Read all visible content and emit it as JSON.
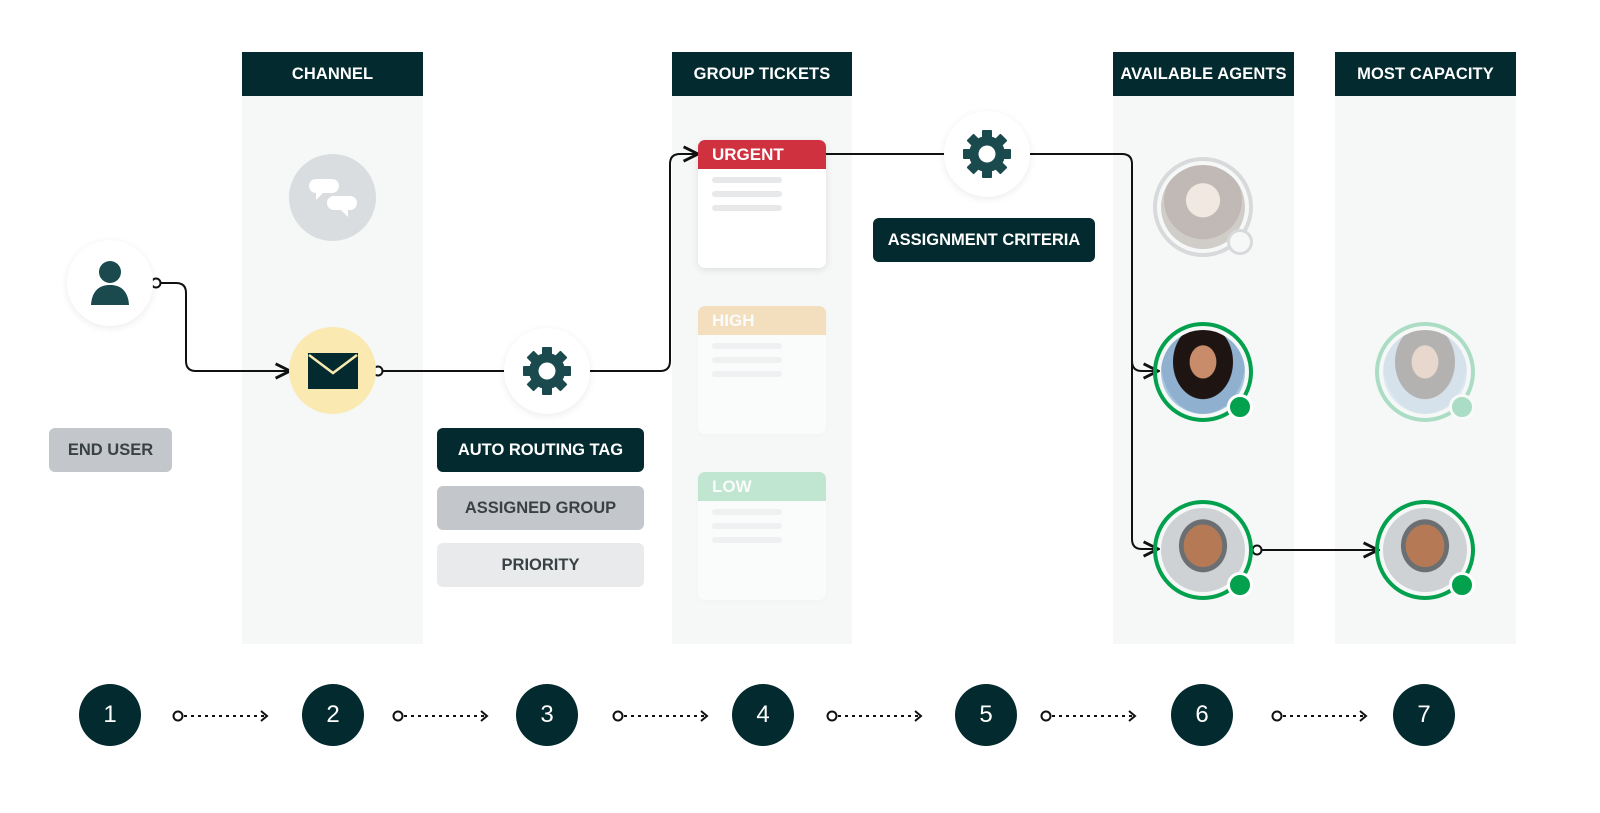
{
  "columns": [
    {
      "id": "channel",
      "label": "CHANNEL"
    },
    {
      "id": "group-tickets",
      "label": "GROUP TICKETS"
    },
    {
      "id": "available-agents",
      "label": "AVAILABLE AGENTS"
    },
    {
      "id": "most-capacity",
      "label": "MOST CAPACITY"
    }
  ],
  "end_user": {
    "label": "END USER",
    "icon": "person-icon"
  },
  "channel": {
    "chat_icon": "chat-bubbles-icon",
    "email_icon": "envelope-icon",
    "chat_state": "inactive",
    "email_state": "active"
  },
  "routing": {
    "icon": "gear-icon",
    "tags": [
      {
        "label": "AUTO ROUTING TAG",
        "style": "dark"
      },
      {
        "label": "ASSIGNED GROUP",
        "style": "mid"
      },
      {
        "label": "PRIORITY",
        "style": "light"
      }
    ]
  },
  "tickets": [
    {
      "label": "URGENT",
      "color": "#d0313f",
      "state": "active"
    },
    {
      "label": "HIGH",
      "color": "#f5dfb8",
      "state": "faded"
    },
    {
      "label": "LOW",
      "color": "#b7e3cc",
      "state": "faded"
    }
  ],
  "assignment": {
    "icon": "gear-icon",
    "label": "ASSIGNMENT CRITERIA"
  },
  "available_agents": [
    {
      "name": "agent-1",
      "status": "offline"
    },
    {
      "name": "agent-2",
      "status": "online"
    },
    {
      "name": "agent-3",
      "status": "online"
    }
  ],
  "most_capacity_agents": [
    {
      "name": "agent-2",
      "status": "online",
      "state": "faded"
    },
    {
      "name": "agent-3",
      "status": "online",
      "state": "selected"
    }
  ],
  "steps": [
    "1",
    "2",
    "3",
    "4",
    "5",
    "6",
    "7"
  ],
  "colors": {
    "dark": "#032a2e",
    "accent_green": "#03a14e",
    "urgent": "#d0313f",
    "email_bg": "#fae9b1"
  }
}
